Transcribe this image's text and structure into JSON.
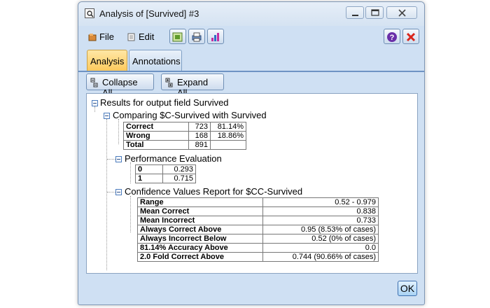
{
  "window": {
    "title": "Analysis of [Survived] #3"
  },
  "menu": {
    "file": "File",
    "edit": "Edit"
  },
  "tabs": [
    {
      "label": "Analysis"
    },
    {
      "label": "Annotations"
    }
  ],
  "actions": {
    "collapse_all": "Collapse All",
    "expand_all": "Expand All"
  },
  "results": {
    "root": "Results for output field Survived",
    "comparing": {
      "label": "Comparing $C-Survived with Survived",
      "rows": [
        {
          "name": "Correct",
          "count": "723",
          "pct": "81.14%"
        },
        {
          "name": "Wrong",
          "count": "168",
          "pct": "18.86%"
        },
        {
          "name": "Total",
          "count": "891",
          "pct": ""
        }
      ]
    },
    "performance": {
      "label": "Performance Evaluation",
      "rows": [
        {
          "name": "0",
          "value": "0.293"
        },
        {
          "name": "1",
          "value": "0.715"
        }
      ]
    },
    "confidence": {
      "label": "Confidence Values Report for $CC-Survived",
      "rows": [
        {
          "name": "Range",
          "value": "0.52 - 0.979"
        },
        {
          "name": "Mean Correct",
          "value": "0.838"
        },
        {
          "name": "Mean Incorrect",
          "value": "0.733"
        },
        {
          "name": "Always Correct Above",
          "value": "0.95 (8.53% of cases)"
        },
        {
          "name": "Always Incorrect Below",
          "value": "0.52 (0% of cases)"
        },
        {
          "name": "81.14% Accuracy Above",
          "value": "0.0"
        },
        {
          "name": "2.0 Fold Correct Above",
          "value": "0.744 (90.66% of cases)"
        }
      ]
    }
  },
  "footer": {
    "ok": "OK"
  },
  "colors": {
    "accent": "#fdc95d",
    "frame": "#cfe0f3",
    "close": "#d9261c",
    "help": "#6a2fa8"
  }
}
